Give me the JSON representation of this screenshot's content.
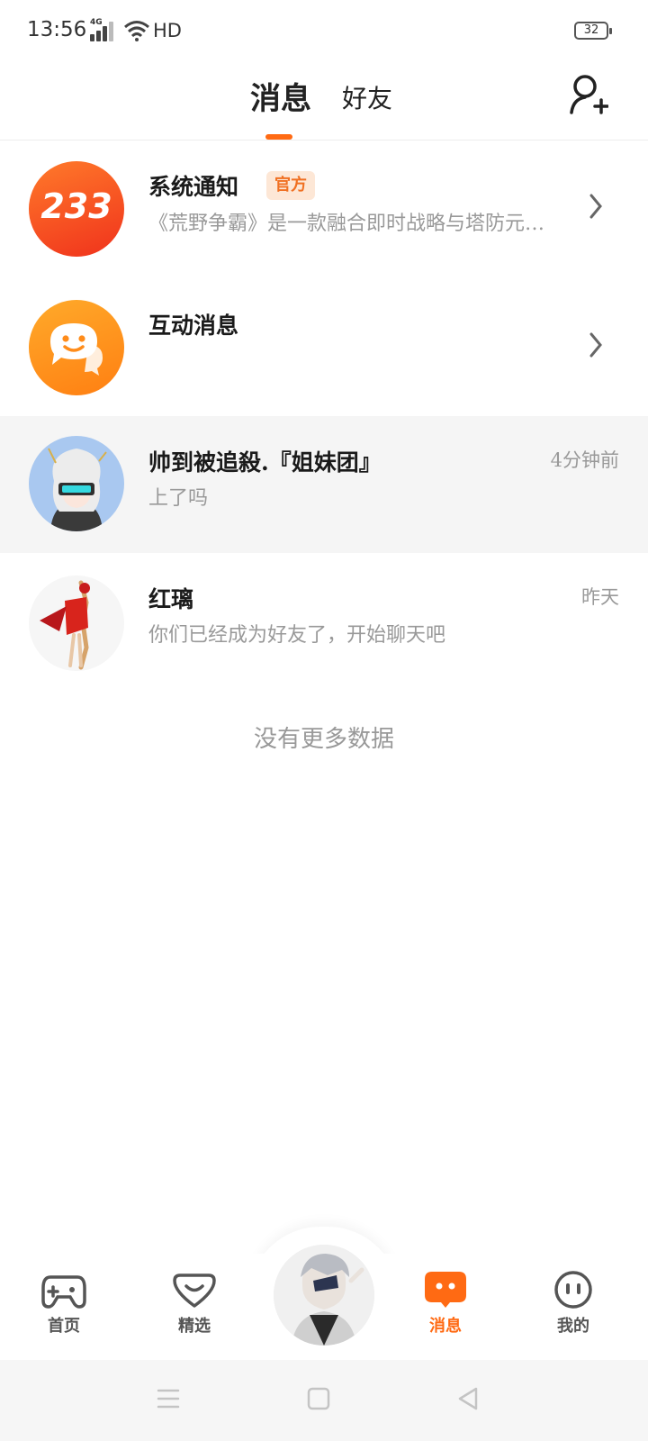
{
  "status_bar": {
    "time": "13:56",
    "network": "4G",
    "hd_label": "HD",
    "battery": "32"
  },
  "header": {
    "tabs": [
      {
        "label": "消息",
        "active": true
      },
      {
        "label": "好友",
        "active": false
      }
    ],
    "add_friend_icon": "add-friend-icon",
    "accent_color": "#ff6a13"
  },
  "conversations": [
    {
      "name": "系统通知",
      "badge": "官方",
      "preview": "《荒野争霸》是一款融合即时战略与塔防元…",
      "time": "",
      "avatar_text": "233",
      "avatar_color": "#ff5a1f"
    },
    {
      "name": "互动消息",
      "preview": "",
      "time": "",
      "avatar_icon": "chat-bubble-icon",
      "avatar_color": "#ff8c1a"
    },
    {
      "name": "帅到被追殺.『姐妹团』",
      "preview": "上了吗",
      "time": "4分钟前"
    },
    {
      "name": "红璃",
      "preview": "你们已经成为好友了，开始聊天吧",
      "time": "昨天"
    }
  ],
  "empty_state": {
    "text": "没有更多数据"
  },
  "bottom_nav": {
    "items": [
      {
        "label": "首页",
        "icon": "gamepad-icon",
        "active": false
      },
      {
        "label": "精选",
        "icon": "heart-icon",
        "active": false
      },
      {
        "label": "消息",
        "icon": "message-icon",
        "active": true
      },
      {
        "label": "我的",
        "icon": "face-icon",
        "active": false
      }
    ]
  }
}
